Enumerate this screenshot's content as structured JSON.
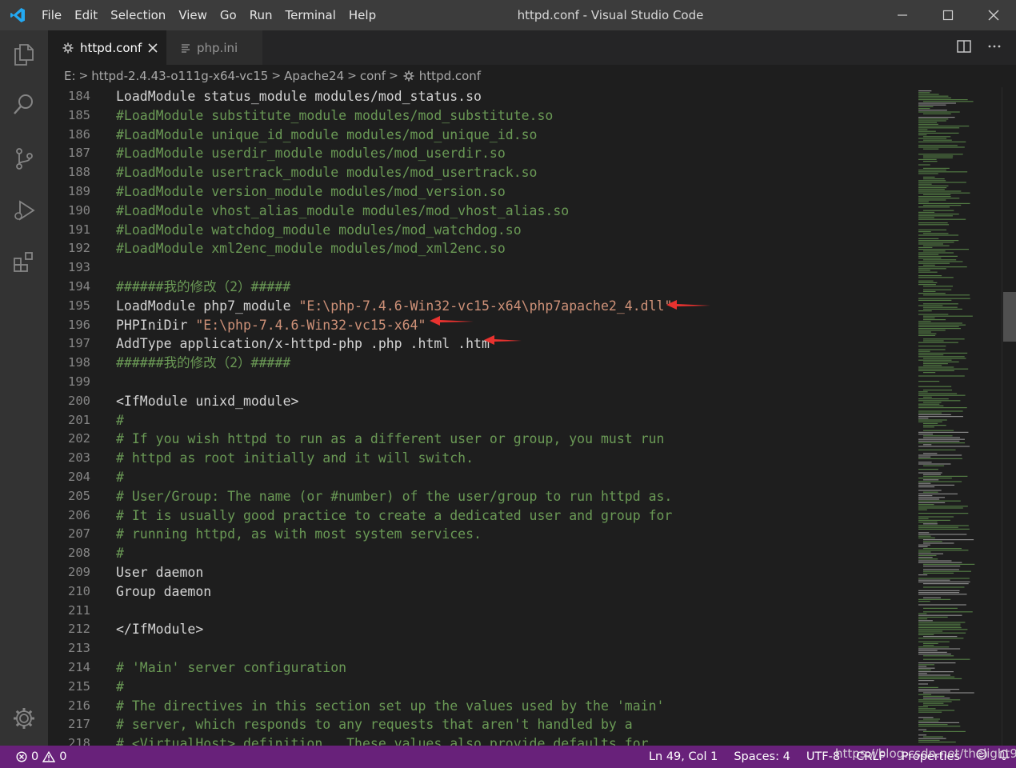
{
  "window": {
    "title": "httpd.conf - Visual Studio Code"
  },
  "menu": [
    "File",
    "Edit",
    "Selection",
    "View",
    "Go",
    "Run",
    "Terminal",
    "Help"
  ],
  "tabs": [
    {
      "label": "httpd.conf",
      "active": true,
      "icon": "gear-icon"
    },
    {
      "label": "php.ini",
      "active": false,
      "icon": "lines-icon"
    }
  ],
  "breadcrumb": [
    "E:",
    "httpd-2.4.43-o111g-x64-vc15",
    "Apache24",
    "conf",
    "httpd.conf"
  ],
  "editor": {
    "lines": [
      {
        "num": "184",
        "parts": [
          [
            "t",
            "LoadModule status_module modules/mod_status.so"
          ]
        ]
      },
      {
        "num": "185",
        "parts": [
          [
            "c",
            "#LoadModule substitute_module modules/mod_substitute.so"
          ]
        ]
      },
      {
        "num": "186",
        "parts": [
          [
            "c",
            "#LoadModule unique_id_module modules/mod_unique_id.so"
          ]
        ]
      },
      {
        "num": "187",
        "parts": [
          [
            "c",
            "#LoadModule userdir_module modules/mod_userdir.so"
          ]
        ]
      },
      {
        "num": "188",
        "parts": [
          [
            "c",
            "#LoadModule usertrack_module modules/mod_usertrack.so"
          ]
        ]
      },
      {
        "num": "189",
        "parts": [
          [
            "c",
            "#LoadModule version_module modules/mod_version.so"
          ]
        ]
      },
      {
        "num": "190",
        "parts": [
          [
            "c",
            "#LoadModule vhost_alias_module modules/mod_vhost_alias.so"
          ]
        ]
      },
      {
        "num": "191",
        "parts": [
          [
            "c",
            "#LoadModule watchdog_module modules/mod_watchdog.so"
          ]
        ]
      },
      {
        "num": "192",
        "parts": [
          [
            "c",
            "#LoadModule xml2enc_module modules/mod_xml2enc.so"
          ]
        ]
      },
      {
        "num": "193",
        "parts": []
      },
      {
        "num": "194",
        "parts": [
          [
            "c",
            "######我的修改（2）#####"
          ]
        ]
      },
      {
        "num": "195",
        "parts": [
          [
            "t",
            "LoadModule php7_module "
          ],
          [
            "s",
            "\"E:\\php-7.4.6-Win32-vc15-x64\\php7apache2_4.dll\""
          ]
        ]
      },
      {
        "num": "196",
        "parts": [
          [
            "t",
            "PHPIniDir "
          ],
          [
            "s",
            "\"E:\\php-7.4.6-Win32-vc15-x64\""
          ]
        ]
      },
      {
        "num": "197",
        "parts": [
          [
            "t",
            "AddType application/x-httpd-php .php .html .htm"
          ]
        ]
      },
      {
        "num": "198",
        "parts": [
          [
            "c",
            "######我的修改（2）#####"
          ]
        ]
      },
      {
        "num": "199",
        "parts": []
      },
      {
        "num": "200",
        "parts": [
          [
            "t",
            "<IfModule unixd_module>"
          ]
        ]
      },
      {
        "num": "201",
        "parts": [
          [
            "c",
            "#"
          ]
        ]
      },
      {
        "num": "202",
        "parts": [
          [
            "c",
            "# If you wish httpd to run as a different user or group, you must run"
          ]
        ]
      },
      {
        "num": "203",
        "parts": [
          [
            "c",
            "# httpd as root initially and it will switch."
          ]
        ]
      },
      {
        "num": "204",
        "parts": [
          [
            "c",
            "#"
          ]
        ]
      },
      {
        "num": "205",
        "parts": [
          [
            "c",
            "# User/Group: The name (or #number) of the user/group to run httpd as."
          ]
        ]
      },
      {
        "num": "206",
        "parts": [
          [
            "c",
            "# It is usually good practice to create a dedicated user and group for"
          ]
        ]
      },
      {
        "num": "207",
        "parts": [
          [
            "c",
            "# running httpd, as with most system services."
          ]
        ]
      },
      {
        "num": "208",
        "parts": [
          [
            "c",
            "#"
          ]
        ]
      },
      {
        "num": "209",
        "parts": [
          [
            "t",
            "User daemon"
          ]
        ]
      },
      {
        "num": "210",
        "parts": [
          [
            "t",
            "Group daemon"
          ]
        ]
      },
      {
        "num": "211",
        "parts": []
      },
      {
        "num": "212",
        "parts": [
          [
            "t",
            "</IfModule>"
          ]
        ]
      },
      {
        "num": "213",
        "parts": []
      },
      {
        "num": "214",
        "parts": [
          [
            "c",
            "# 'Main' server configuration"
          ]
        ]
      },
      {
        "num": "215",
        "parts": [
          [
            "c",
            "#"
          ]
        ]
      },
      {
        "num": "216",
        "parts": [
          [
            "c",
            "# The directives in this section set up the values used by the 'main'"
          ]
        ]
      },
      {
        "num": "217",
        "parts": [
          [
            "c",
            "# server, which responds to any requests that aren't handled by a"
          ]
        ]
      },
      {
        "num": "218",
        "parts": [
          [
            "c",
            "# <VirtualHost> definition.  These values also provide defaults for"
          ]
        ]
      }
    ]
  },
  "statusbar": {
    "errors": "0",
    "warnings": "0",
    "position": "Ln 49, Col 1",
    "spaces": "Spaces: 4",
    "encoding": "UTF-8",
    "eol": "CRLF",
    "language": "Properties"
  },
  "watermark": "https://blog.csdn.net/thelight92",
  "colors": {
    "statusbar": "#68217a",
    "comment": "#6a9955",
    "string": "#ce9178",
    "annotation_arrow": "#e8322f"
  }
}
